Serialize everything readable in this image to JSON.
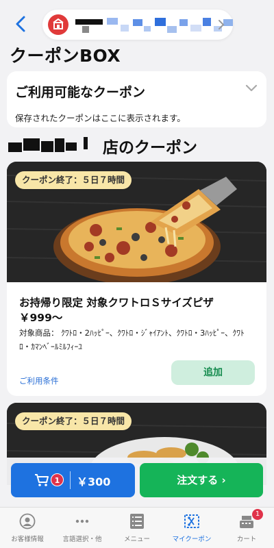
{
  "header": {
    "back_icon": "chevron-left-icon",
    "store_logo_icon": "store-logo-icon",
    "chevron_icon": "chevron-right-icon"
  },
  "page_title": "クーポンBOX",
  "available": {
    "title": "ご利用可能なクーポン",
    "description": "保存されたクーポンはここに表示されます。",
    "chevron_icon": "chevron-down-icon"
  },
  "store_section": {
    "suffix": "店のクーポン"
  },
  "coupons": [
    {
      "badge": "クーポン終了：５日７時間",
      "title": "お持帰り限定 対象クワトロＳサイズピザ",
      "price": "￥999～",
      "items": "対象商品： ｸﾜﾄﾛ・2ﾊｯﾋﾟｰ、ｸﾜﾄﾛ・ｼﾞｬｲｱﾝﾄ、ｸﾜﾄﾛ・3ﾊｯﾋﾟｰ、ｸﾜﾄﾛ・ｶﾏﾝﾍﾞｰﾙﾐﾙﾌｨｰﾕ",
      "terms": "ご利用条件",
      "add_label": "追加"
    },
    {
      "badge": "クーポン終了：５日７時間"
    }
  ],
  "cart": {
    "icon": "cart-icon",
    "count": "1",
    "total": "￥300"
  },
  "order": {
    "label": "注文する ›"
  },
  "tabs": [
    {
      "label": "お客様情報",
      "icon": "user-icon"
    },
    {
      "label": "言語選択・他",
      "icon": "more-icon"
    },
    {
      "label": "メニュー",
      "icon": "menu-icon"
    },
    {
      "label": "マイクーポン",
      "icon": "coupon-icon",
      "active": true
    },
    {
      "label": "カート",
      "icon": "register-icon",
      "badge": "1"
    }
  ],
  "colors": {
    "accent_blue": "#1e72e0",
    "order_green": "#15b458",
    "badge_red": "#e0334a",
    "badge_yellow": "#f8e6a8"
  }
}
